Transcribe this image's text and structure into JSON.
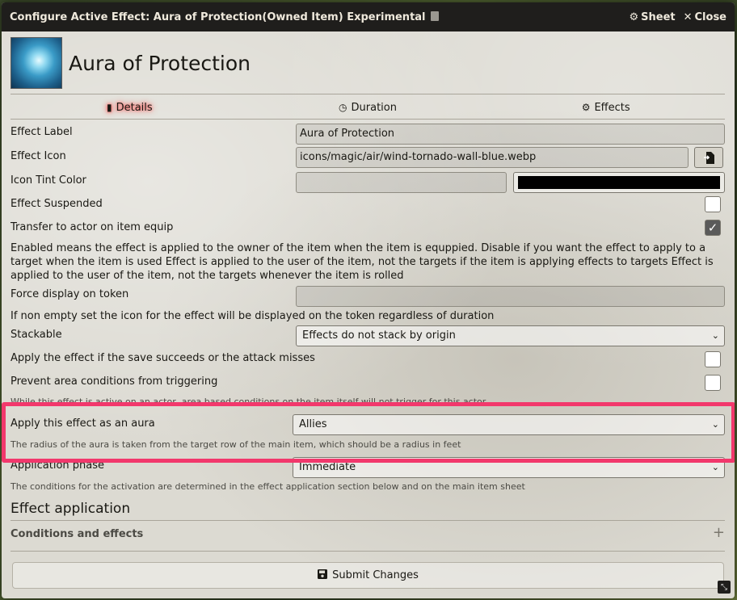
{
  "titlebar": {
    "title": "Configure Active Effect: Aura of Protection(Owned Item) Experimental",
    "sheet_label": "Sheet",
    "close_label": "Close"
  },
  "header": {
    "name": "Aura of Protection"
  },
  "tabs": [
    {
      "label": "Details",
      "icon": "book-icon",
      "active": true
    },
    {
      "label": "Duration",
      "icon": "clock-icon"
    },
    {
      "label": "Effects",
      "icon": "cogs-icon"
    }
  ],
  "fields": {
    "effect_label": {
      "label": "Effect Label",
      "value": "Aura of Protection"
    },
    "effect_icon": {
      "label": "Effect Icon",
      "value": "icons/magic/air/wind-tornado-wall-blue.webp"
    },
    "icon_tint": {
      "label": "Icon Tint Color",
      "value": "",
      "swatch": "#000000"
    },
    "effect_suspended": {
      "label": "Effect Suspended",
      "checked": false
    },
    "transfer": {
      "label": "Transfer to actor on item equip",
      "checked": true,
      "hint": "Enabled means the effect is applied to the owner of the item when the item is equppied. Disable if you want the effect to apply to a target when the item is used Effect is applied to the user of the item, not the targets if the item is applying effects to targets Effect is applied to the user of the item, not the targets whenever the item is rolled"
    },
    "force_display": {
      "label": "Force display on token",
      "value": "",
      "hint": "If non empty set the icon for the effect will be displayed on the token regardless of duration"
    },
    "stackable": {
      "label": "Stackable",
      "value": "Effects do not stack by origin"
    },
    "apply_save": {
      "label": "Apply the effect if the save succeeds or the attack misses",
      "checked": false
    },
    "prevent_area": {
      "label": "Prevent area conditions from triggering",
      "checked": false,
      "hint": "While this effect is active on an actor, area based conditions on the item itself will not trigger for this actor"
    },
    "aura": {
      "label": "Apply this effect as an aura",
      "value": "Allies",
      "hint": "The radius of the aura is taken from the target row of the main item, which should be a radius in feet"
    },
    "application_phase": {
      "label": "Application phase",
      "value": "Immediate",
      "hint": "The conditions for the activation are determined in the effect application section below and on the main item sheet"
    }
  },
  "sections": {
    "effect_application": "Effect application",
    "conditions_and_effects": "Conditions and effects"
  },
  "submit_label": "Submit Changes",
  "colors": {
    "highlight": "#f2386c",
    "titlebar": "#1f1e1c"
  }
}
